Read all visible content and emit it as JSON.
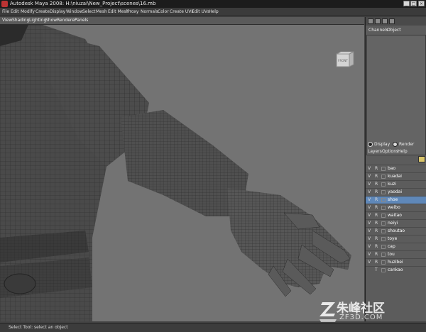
{
  "window": {
    "title": "Autodesk Maya 2008: H:\\niuzai\\New_Project\\scenes\\16.mb",
    "buttons": [
      "_",
      "□",
      "×"
    ]
  },
  "menu": [
    "File",
    "Edit",
    "Modify",
    "Create",
    "Display",
    "Window",
    "Select",
    "Mesh",
    "Edit Mesh",
    "Proxy",
    "Normals",
    "Color",
    "Create UVs",
    "Edit UVs",
    "Help"
  ],
  "panel_menu": [
    "View",
    "Shading",
    "Lighting",
    "Show",
    "Renderer",
    "Panels"
  ],
  "viewport": {
    "view_cube_label": "FRONT",
    "camera_label": "persp",
    "background": "#737373"
  },
  "channel_box": {
    "menu": [
      "Channels",
      "Object"
    ]
  },
  "layer_editor": {
    "mode": {
      "display": "Display",
      "render": "Render",
      "selected": "Display"
    },
    "menu": [
      "Layers",
      "Options",
      "Help"
    ],
    "layers": [
      {
        "v": "V",
        "r": "R",
        "name": "bao",
        "selected": false
      },
      {
        "v": "V",
        "r": "R",
        "name": "kuadai",
        "selected": false
      },
      {
        "v": "V",
        "r": "R",
        "name": "kuzi",
        "selected": false
      },
      {
        "v": "V",
        "r": "R",
        "name": "yaodai",
        "selected": false
      },
      {
        "v": "V",
        "r": "R",
        "name": "shoe",
        "selected": true
      },
      {
        "v": "V",
        "r": "R",
        "name": "weibo",
        "selected": false
      },
      {
        "v": "V",
        "r": "R",
        "name": "waitao",
        "selected": false
      },
      {
        "v": "V",
        "r": "R",
        "name": "neiyi",
        "selected": false
      },
      {
        "v": "V",
        "r": "R",
        "name": "shoutao",
        "selected": false
      },
      {
        "v": "V",
        "r": "R",
        "name": "toye",
        "selected": false
      },
      {
        "v": "V",
        "r": "R",
        "name": "cap",
        "selected": false
      },
      {
        "v": "V",
        "r": "R",
        "name": "tou",
        "selected": false
      },
      {
        "v": "V",
        "r": "R",
        "name": "huzibei",
        "selected": false
      },
      {
        "v": "",
        "r": "T",
        "name": "cankao",
        "selected": false
      }
    ]
  },
  "status": {
    "text": "Select Tool: select an object"
  },
  "watermark": {
    "line1": "朱峰社区",
    "line2": "ZF3D.COM"
  },
  "colors": {
    "selection": "#5f88b9",
    "panel": "#5c5c5c",
    "titlebar": "#1c1c1c"
  }
}
